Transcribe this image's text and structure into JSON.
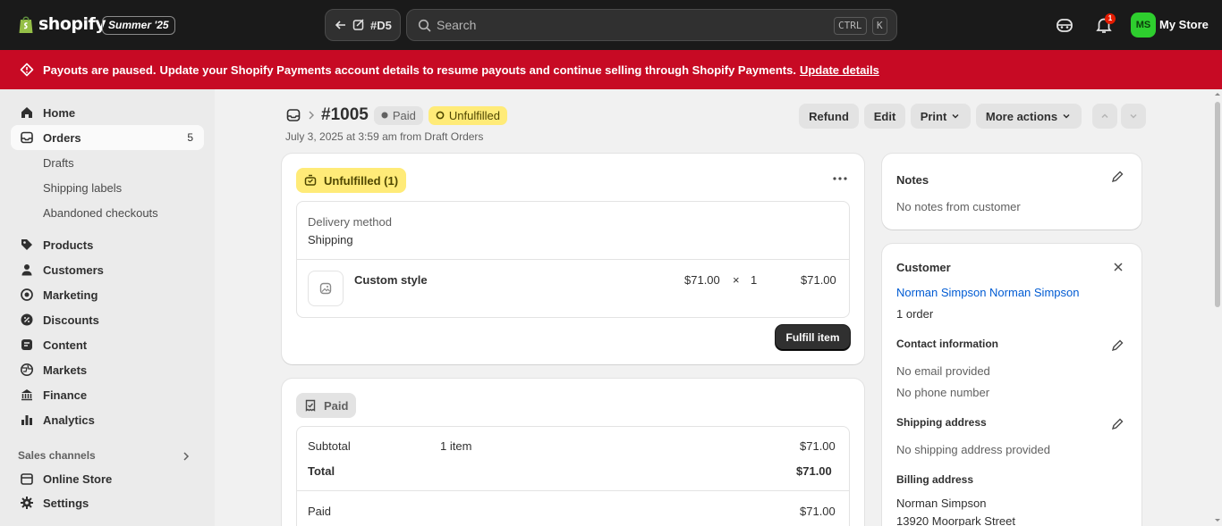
{
  "topbar": {
    "logo_text": "shopify",
    "edition": "Summer '25",
    "back_label": "#D5",
    "search_placeholder": "Search",
    "shortcut_ctrl": "CTRL",
    "shortcut_k": "K",
    "notification_count": "1",
    "store_initials": "MS",
    "store_name": "My Store"
  },
  "banner": {
    "title": "Payouts are paused.",
    "message": "Update your Shopify Payments account details to resume payouts and continue selling through Shopify Payments.",
    "link": "Update details",
    "color": "#c70a24"
  },
  "sidebar": {
    "home": "Home",
    "orders": "Orders",
    "orders_count": "5",
    "drafts": "Drafts",
    "shipping_labels": "Shipping labels",
    "abandoned": "Abandoned checkouts",
    "products": "Products",
    "customers": "Customers",
    "marketing": "Marketing",
    "discounts": "Discounts",
    "content": "Content",
    "markets": "Markets",
    "finance": "Finance",
    "analytics": "Analytics",
    "sales_channels": "Sales channels",
    "online_store": "Online Store",
    "settings": "Settings"
  },
  "order": {
    "number": "#1005",
    "payment_status": "Paid",
    "fulfillment_status": "Unfulfilled",
    "meta": "July 3, 2025 at 3:59 am from Draft Orders",
    "actions": {
      "refund": "Refund",
      "edit": "Edit",
      "print": "Print",
      "more": "More actions"
    }
  },
  "fulfillment_card": {
    "badge": "Unfulfilled (1)",
    "delivery_label": "Delivery method",
    "delivery_value": "Shipping",
    "item_name": "Custom style",
    "item_price": "$71.00",
    "times": "×",
    "item_qty": "1",
    "item_total": "$71.00",
    "fulfill_button": "Fulfill item"
  },
  "payment_card": {
    "badge": "Paid",
    "subtotal_label": "Subtotal",
    "subtotal_items": "1 item",
    "subtotal_value": "$71.00",
    "total_label": "Total",
    "total_value": "$71.00",
    "paid_label": "Paid",
    "paid_value": "$71.00"
  },
  "notes_card": {
    "title": "Notes",
    "text": "No notes from customer"
  },
  "customer_card": {
    "title": "Customer",
    "name": "Norman Simpson Norman Simpson",
    "orders": "1 order",
    "contact_title": "Contact information",
    "email": "No email provided",
    "phone": "No phone number",
    "shipping_title": "Shipping address",
    "shipping_text": "No shipping address provided",
    "billing_title": "Billing address",
    "billing_name": "Norman Simpson",
    "billing_street": "13920 Moorpark Street"
  }
}
